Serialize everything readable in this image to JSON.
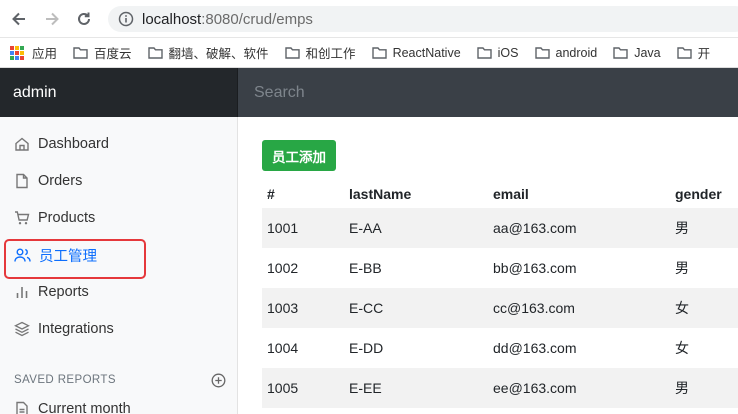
{
  "browser": {
    "url_host": "localhost",
    "url_rest": ":8080/crud/emps",
    "bookmarks": [
      {
        "label": "应用",
        "icon": "apps-icon"
      },
      {
        "label": "百度云",
        "icon": "folder-icon"
      },
      {
        "label": "翻墙、破解、软件",
        "icon": "folder-icon"
      },
      {
        "label": "和创工作",
        "icon": "folder-icon"
      },
      {
        "label": "ReactNative",
        "icon": "folder-icon"
      },
      {
        "label": "iOS",
        "icon": "folder-icon"
      },
      {
        "label": "android",
        "icon": "folder-icon"
      },
      {
        "label": "Java",
        "icon": "folder-icon"
      },
      {
        "label": "开",
        "icon": "folder-icon"
      }
    ]
  },
  "navbar": {
    "brand": "admin",
    "search_placeholder": "Search"
  },
  "sidebar": {
    "items": [
      {
        "label": "Dashboard",
        "icon": "home-icon"
      },
      {
        "label": "Orders",
        "icon": "file-icon"
      },
      {
        "label": "Products",
        "icon": "cart-icon"
      },
      {
        "label": "员工管理",
        "icon": "users-icon"
      },
      {
        "label": "Reports",
        "icon": "bar-chart-icon"
      },
      {
        "label": "Integrations",
        "icon": "layers-icon"
      }
    ],
    "saved_reports_heading": "SAVED REPORTS",
    "saved_reports": [
      {
        "label": "Current month",
        "icon": "file-text-icon"
      }
    ]
  },
  "main": {
    "add_button": "员工添加",
    "table": {
      "headers": [
        "#",
        "lastName",
        "email",
        "gender"
      ],
      "rows": [
        [
          "1001",
          "E-AA",
          "aa@163.com",
          "男"
        ],
        [
          "1002",
          "E-BB",
          "bb@163.com",
          "男"
        ],
        [
          "1003",
          "E-CC",
          "cc@163.com",
          "女"
        ],
        [
          "1004",
          "E-DD",
          "dd@163.com",
          "女"
        ],
        [
          "1005",
          "E-EE",
          "ee@163.com",
          "男"
        ]
      ]
    }
  },
  "colors": {
    "brand_bg": "#23272b",
    "navbar_bg": "#343a40",
    "active_link": "#0d6efd",
    "add_button": "#28a745",
    "highlight_box": "#e5383b"
  }
}
